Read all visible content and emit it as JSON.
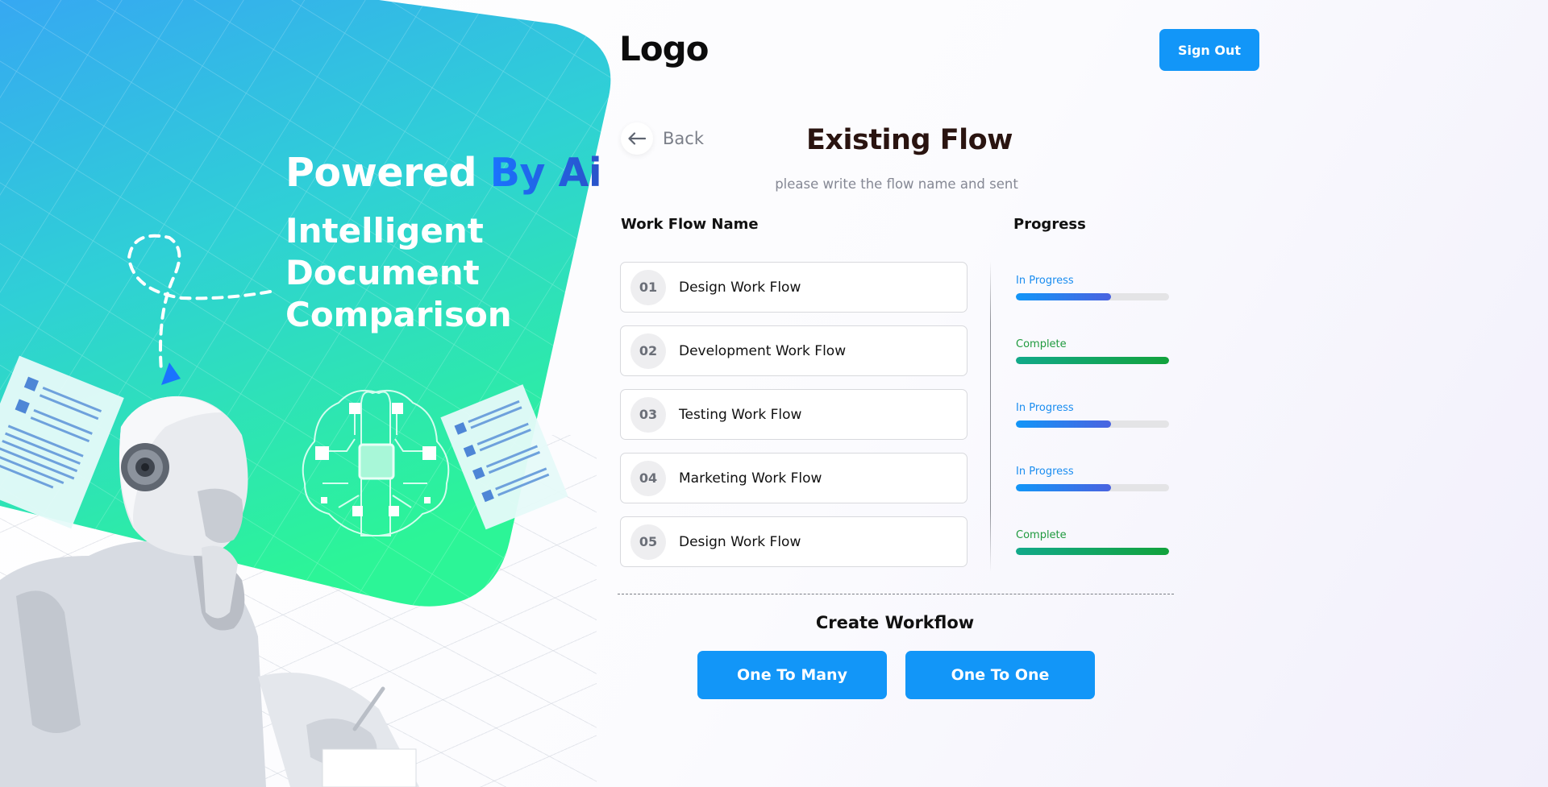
{
  "hero": {
    "headline_white": "Powered",
    "headline_accent": "By Ai",
    "subline": [
      "Intelligent",
      "Document",
      "Comparison"
    ]
  },
  "header": {
    "logo": "Logo",
    "sign_out_label": "Sign Out"
  },
  "nav": {
    "back_label": "Back",
    "back_icon": "arrow-left-icon"
  },
  "page": {
    "title": "Existing Flow",
    "subtitle": "please write the flow name  and sent"
  },
  "table": {
    "name_header": "Work Flow Name",
    "progress_header": "Progress",
    "rows": [
      {
        "number": "01",
        "name": "Design Work Flow",
        "status": "In Progress",
        "state": "in-progress",
        "progress": 0.62
      },
      {
        "number": "02",
        "name": "Development Work Flow",
        "status": "Complete",
        "state": "complete",
        "progress": 1.0
      },
      {
        "number": "03",
        "name": "Testing Work Flow",
        "status": "In Progress",
        "state": "in-progress",
        "progress": 0.62
      },
      {
        "number": "04",
        "name": "Marketing Work Flow",
        "status": "In Progress",
        "state": "in-progress",
        "progress": 0.62
      },
      {
        "number": "05",
        "name": "Design Work Flow",
        "status": "Complete",
        "state": "complete",
        "progress": 1.0
      }
    ]
  },
  "create": {
    "title": "Create Workflow",
    "one_to_many_label": "One To Many",
    "one_to_one_label": "One To One"
  },
  "colors": {
    "primary": "#1296f8",
    "in_progress": "#1a8df0",
    "complete": "#1f9a3e",
    "hero_gradient_top": "#2fb0f0",
    "hero_gradient_bottom": "#2cf59a"
  }
}
